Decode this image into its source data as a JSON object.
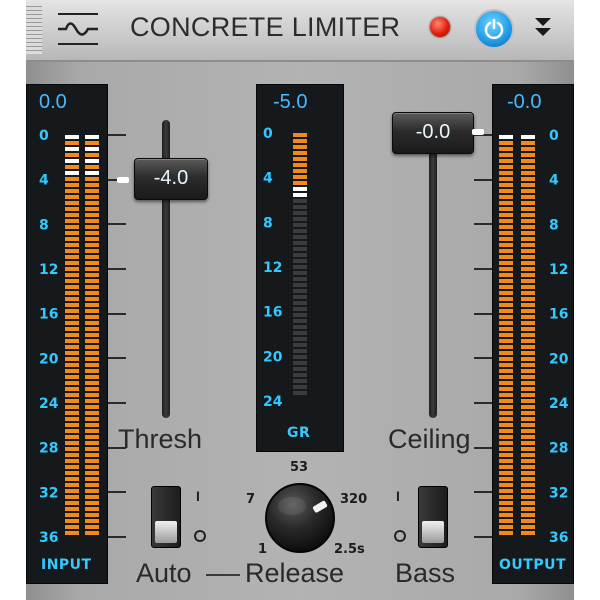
{
  "header": {
    "title": "CONCRETE LIMITER",
    "logo_icon": "waveform-icon",
    "led_color": "#e21f0b",
    "power_icon": "power-icon",
    "power_color": "#1d9be8",
    "menu_icon": "double-chevron-down-icon"
  },
  "scale": [
    "0",
    "4",
    "8",
    "12",
    "16",
    "20",
    "24",
    "28",
    "32",
    "36"
  ],
  "input_meter": {
    "readout": "0.0",
    "label": "INPUT",
    "level_db": 0,
    "peak_db": 0,
    "segment_color": "#f08a1c"
  },
  "threshold": {
    "value_text": "-4.0",
    "value_db": -4.0,
    "label": "Thresh"
  },
  "gr_meter": {
    "readout": "-5.0",
    "label": "GR",
    "reduction_db": 5.0
  },
  "ceiling": {
    "value_text": "-0.0",
    "value_db": 0.0,
    "label": "Ceiling"
  },
  "output_meter": {
    "readout": "-0.0",
    "label": "OUTPUT",
    "level_db": 0,
    "peak_db": 0
  },
  "release": {
    "label": "Release",
    "scale_labels": {
      "min": "1",
      "low": "7",
      "top": "53",
      "high": "320",
      "max": "2.5s"
    },
    "position": 0.72
  },
  "auto_switch": {
    "label": "Auto",
    "on_mark": "I",
    "state": "off"
  },
  "bass_switch": {
    "label": "Bass",
    "on_mark": "I",
    "state": "off"
  }
}
